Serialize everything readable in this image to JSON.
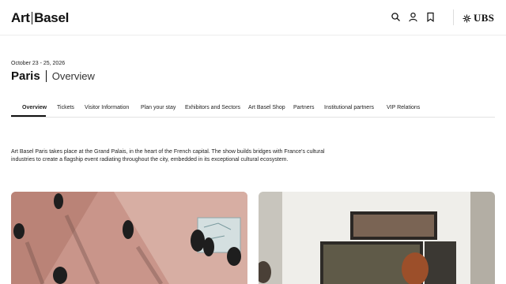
{
  "header": {
    "logo_left": "Art",
    "logo_right": "Basel",
    "icons": [
      "search-icon",
      "user-icon",
      "bookmark-icon"
    ],
    "partner_logo": "UBS"
  },
  "event": {
    "dates": "October 23 - 25, 2026",
    "city": "Paris",
    "section": "Overview"
  },
  "tabs": [
    {
      "label": "Overview",
      "active": true
    },
    {
      "label": "Tickets"
    },
    {
      "label": "Visitor Information"
    },
    {
      "label": "Plan your stay"
    },
    {
      "label": "Exhibitors and Sectors"
    },
    {
      "label": "Art Basel Shop"
    },
    {
      "label": "Partners"
    },
    {
      "label": "Institutional partners"
    },
    {
      "label": "VIP Relations"
    }
  ],
  "intro": "Art Basel Paris takes place at the Grand Palais, in the heart of the French capital. The show builds bridges with France's cultural industries to create a flagship event radiating throughout the city, embedded in its exceptional cultural ecosystem.",
  "cards": [
    {
      "image": "fair-visitors-aerial-photo"
    },
    {
      "image": "gallery-booth-paintings-photo"
    }
  ],
  "colors": {
    "text": "#111111",
    "divider": "#e3e3e3",
    "floor": "#c9958a"
  }
}
